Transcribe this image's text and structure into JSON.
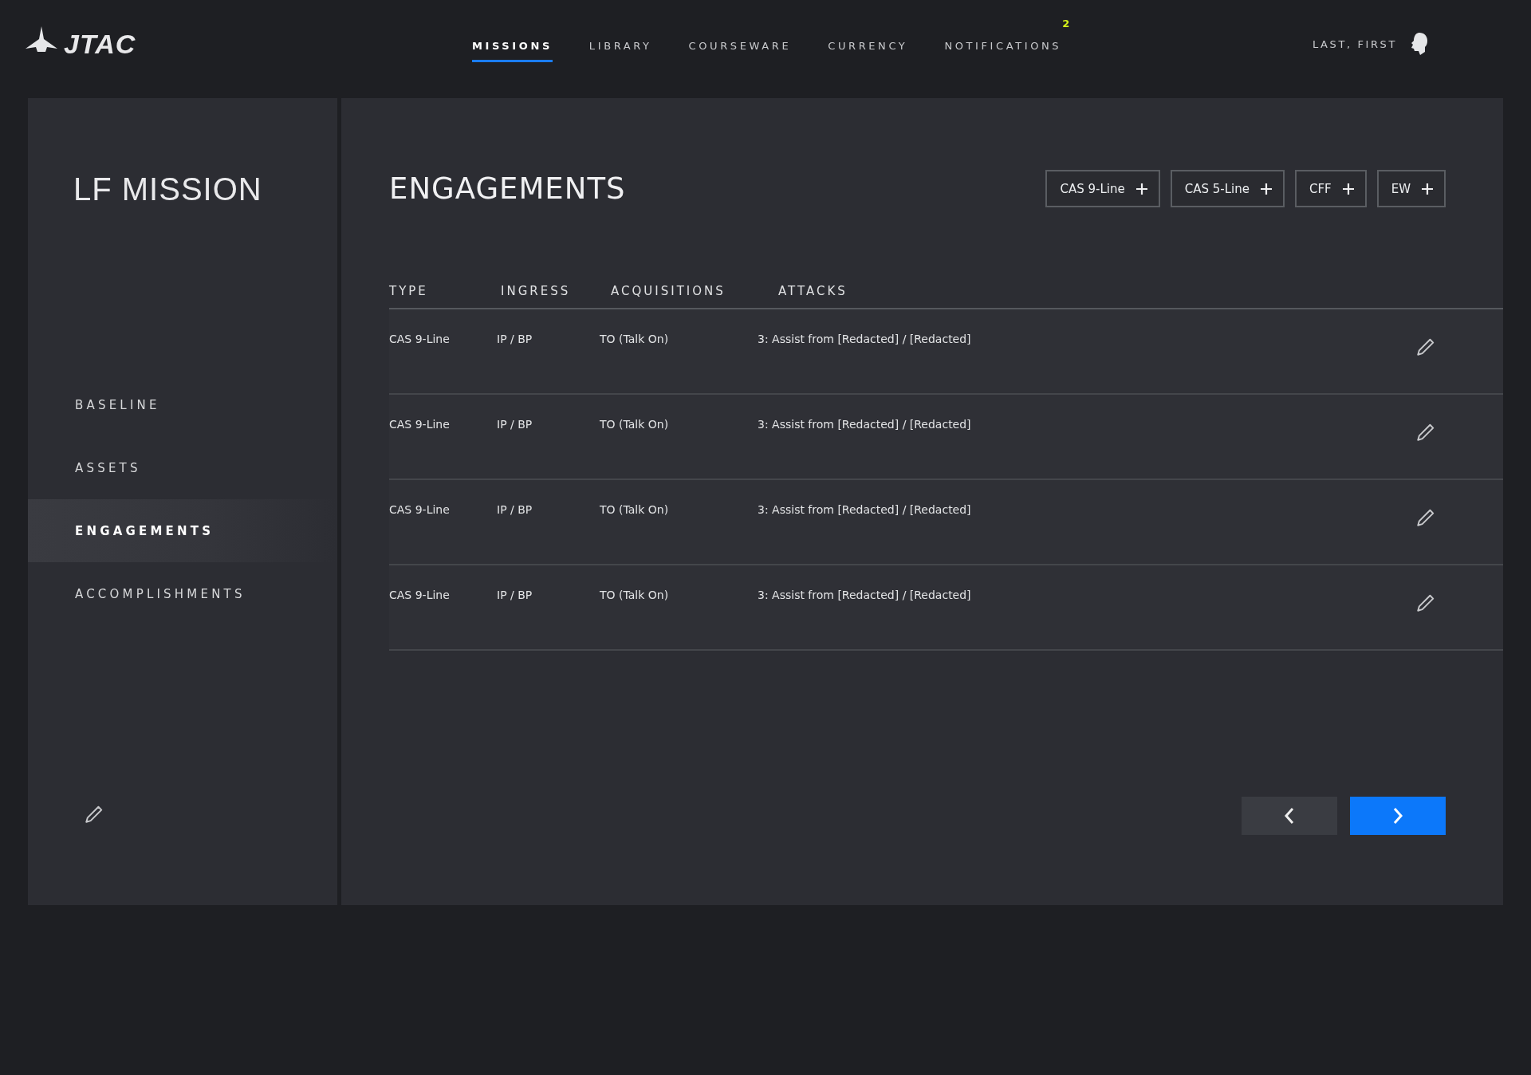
{
  "header": {
    "logo": "JTAC",
    "nav": [
      {
        "label": "MISSIONS",
        "selected": true
      },
      {
        "label": "LIBRARY",
        "selected": false
      },
      {
        "label": "COURSEWARE",
        "selected": false
      },
      {
        "label": "CURRENCY",
        "selected": false
      },
      {
        "label": "NOTIFICATIONS",
        "selected": false,
        "badge": "2"
      }
    ],
    "user": "LAST, FIRST"
  },
  "sidebar": {
    "title": "LF MISSION",
    "items": [
      {
        "label": "BASELINE",
        "selected": false
      },
      {
        "label": "ASSETS",
        "selected": false
      },
      {
        "label": "ENGAGEMENTS",
        "selected": true
      },
      {
        "label": "ACCOMPLISHMENTS",
        "selected": false
      }
    ]
  },
  "content": {
    "title": "ENGAGEMENTS",
    "add_buttons": [
      "CAS 9-Line",
      "CAS 5-Line",
      "CFF",
      "EW"
    ],
    "table": {
      "columns": [
        "TYPE",
        "INGRESS",
        "ACQUISITIONS",
        "ATTACKS"
      ],
      "rows": [
        [
          "CAS 9-Line",
          "IP / BP",
          "TO (Talk On)",
          "3: Assist from [Redacted] / [Redacted]"
        ],
        [
          "CAS 9-Line",
          "IP / BP",
          "TO (Talk On)",
          "3: Assist from [Redacted] / [Redacted]"
        ],
        [
          "CAS 9-Line",
          "IP / BP",
          "TO (Talk On)",
          "3: Assist from [Redacted] / [Redacted]"
        ],
        [
          "CAS 9-Line",
          "IP / BP",
          "TO (Talk On)",
          "3: Assist from [Redacted] / [Redacted]"
        ]
      ]
    }
  }
}
